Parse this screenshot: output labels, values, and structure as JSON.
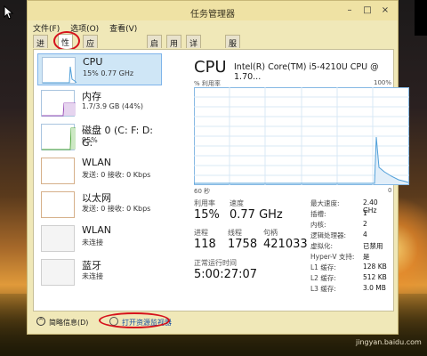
{
  "window": {
    "title": "任务管理器",
    "controls": {
      "minimize": "–",
      "maximize": "□",
      "close": "×"
    }
  },
  "menu": [
    "文件(F)",
    "选项(O)",
    "查看(V)"
  ],
  "tabs": [
    "进程",
    "性能",
    "应用历史记录",
    "启动",
    "用户",
    "详细信息",
    "服务"
  ],
  "active_tab": "性能",
  "sidebar": {
    "items": [
      {
        "name": "CPU",
        "sub": "15% 0.77 GHz"
      },
      {
        "name": "内存",
        "sub": "1.7/3.9 GB (44%)"
      },
      {
        "name": "磁盘 0 (C: F: D: G:",
        "sub": "95%"
      },
      {
        "name": "WLAN",
        "sub": "发送: 0 接收: 0 Kbps"
      },
      {
        "name": "以太网",
        "sub": "发送: 0 接收: 0 Kbps"
      },
      {
        "name": "WLAN",
        "sub": "未连接"
      },
      {
        "name": "蓝牙",
        "sub": "未连接"
      }
    ]
  },
  "detail": {
    "title": "CPU",
    "cpu_model": "Intel(R) Core(TM) i5-4210U CPU @ 1.70...",
    "graph_label": "% 利用率",
    "graph_max": "100%",
    "axis_left": "60 秒",
    "axis_right": "0",
    "stats": {
      "utilization_label": "利用率",
      "utilization": "15%",
      "speed_label": "速度",
      "speed": "0.77 GHz",
      "processes_label": "进程",
      "processes": "118",
      "threads_label": "线程",
      "threads": "1758",
      "handles_label": "句柄",
      "handles": "421033",
      "uptime_label": "正常运行时间",
      "uptime": "5:00:27:07"
    },
    "info": [
      {
        "label": "最大速度:",
        "value": "2.40 GHz"
      },
      {
        "label": "插槽:",
        "value": "1"
      },
      {
        "label": "内核:",
        "value": "2"
      },
      {
        "label": "逻辑处理器:",
        "value": "4"
      },
      {
        "label": "虚拟化:",
        "value": "已禁用"
      },
      {
        "label": "Hyper-V 支持:",
        "value": "是"
      },
      {
        "label": "L1 缓存:",
        "value": "128 KB"
      },
      {
        "label": "L2 缓存:",
        "value": "512 KB"
      },
      {
        "label": "L3 缓存:",
        "value": "3.0 MB"
      }
    ]
  },
  "bottom": {
    "fewer_details": "简略信息(D)",
    "open_monitor": "打开资源监视器"
  },
  "watermark": "jingyan.baidu.com",
  "colors": {
    "highlight_red": "#d6121c",
    "selected_bg": "#cfe6f6",
    "cpu_graph": "#4f9fd9",
    "memory_graph": "#9b4fb8",
    "disk_graph": "#4fa83a"
  }
}
